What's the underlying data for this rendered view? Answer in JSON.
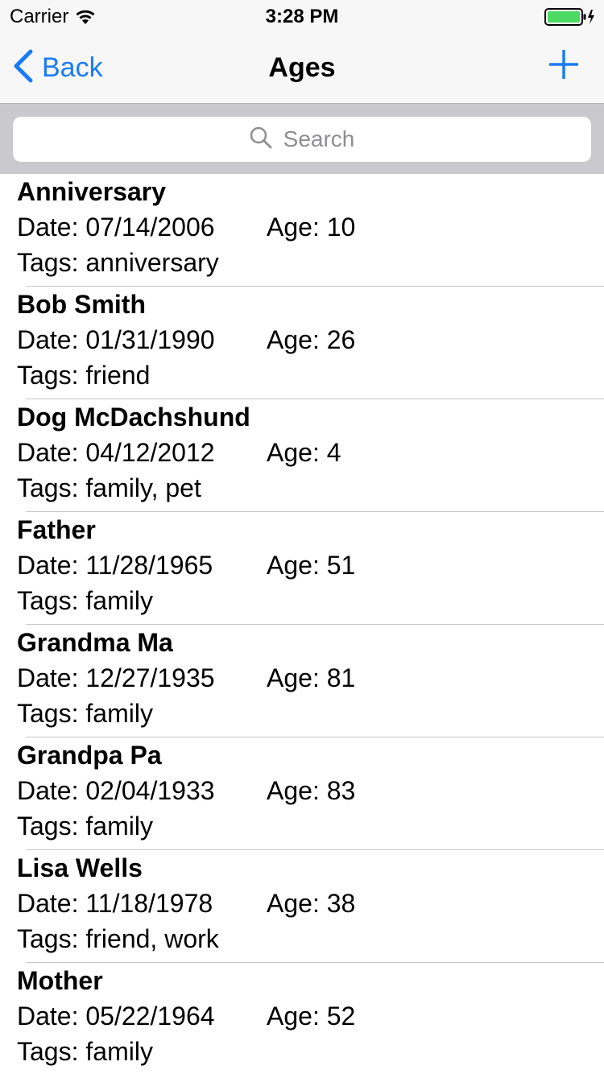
{
  "status_bar": {
    "carrier": "Carrier",
    "time": "3:28 PM",
    "battery_color": "#4cd964"
  },
  "nav": {
    "back_label": "Back",
    "title": "Ages",
    "add_icon": "plus-icon",
    "accent_color": "#1a7cf5"
  },
  "search": {
    "placeholder": "Search"
  },
  "entries": [
    {
      "name": "Anniversary",
      "date": "Date: 07/14/2006",
      "age": "Age: 10",
      "tags": "Tags: anniversary"
    },
    {
      "name": "Bob Smith",
      "date": "Date: 01/31/1990",
      "age": "Age: 26",
      "tags": "Tags: friend"
    },
    {
      "name": "Dog McDachshund",
      "date": "Date: 04/12/2012",
      "age": "Age: 4",
      "tags": "Tags: family, pet"
    },
    {
      "name": "Father",
      "date": "Date: 11/28/1965",
      "age": "Age: 51",
      "tags": "Tags: family"
    },
    {
      "name": "Grandma Ma",
      "date": "Date: 12/27/1935",
      "age": "Age: 81",
      "tags": "Tags: family"
    },
    {
      "name": "Grandpa Pa",
      "date": "Date: 02/04/1933",
      "age": "Age: 83",
      "tags": "Tags: family"
    },
    {
      "name": "Lisa Wells",
      "date": "Date: 11/18/1978",
      "age": "Age: 38",
      "tags": "Tags: friend, work"
    },
    {
      "name": "Mother",
      "date": "Date: 05/22/1964",
      "age": "Age: 52",
      "tags": "Tags: family"
    }
  ]
}
